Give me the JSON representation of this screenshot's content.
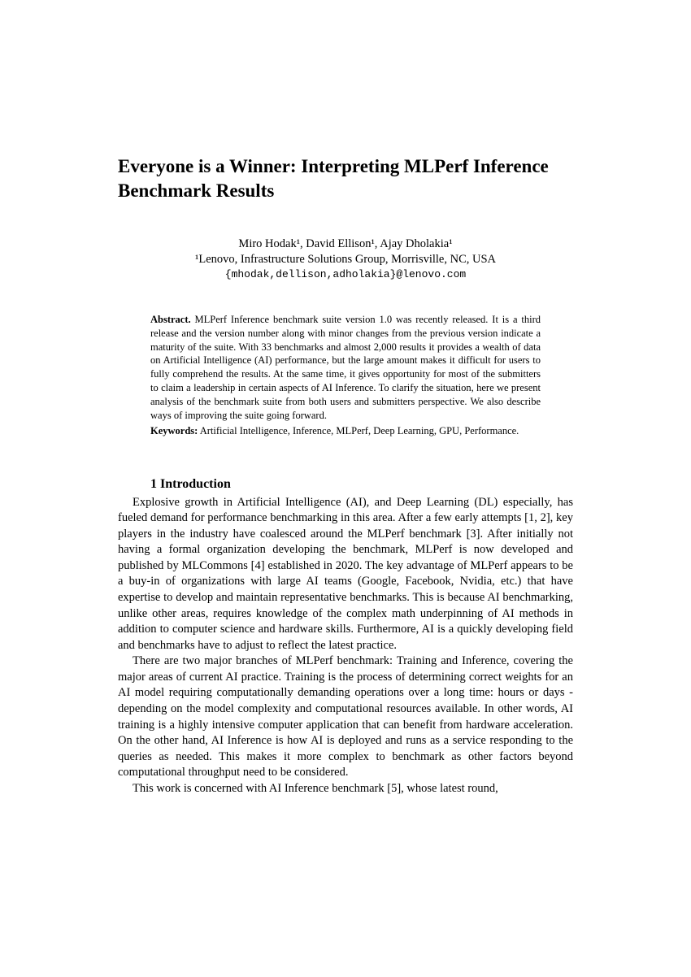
{
  "title": "Everyone is a Winner: Interpreting MLPerf Inference Benchmark Results",
  "authors_line": "Miro Hodak¹, David Ellison¹, Ajay Dholakia¹",
  "affiliation": "¹Lenovo, Infrastructure Solutions Group, Morrisville, NC, USA",
  "emails": "{mhodak,dellison,adholakia}@lenovo.com",
  "abstract_label": "Abstract.",
  "abstract_text": " MLPerf Inference benchmark suite version 1.0 was recently released. It is a third release and the version number along with minor changes from the previous version indicate a maturity of the suite. With 33 benchmarks and almost 2,000 results it provides a wealth of data on Artificial Intelligence (AI) performance, but the large amount makes it difficult for users to fully comprehend the results. At the same time, it gives opportunity for most of the submitters to claim a leadership in certain aspects of AI Inference. To clarify the situation, here we present analysis of the benchmark suite from both users and submitters perspective. We also describe ways of improving the suite going forward.",
  "keywords_label": "Keywords:",
  "keywords_text": " Artificial Intelligence, Inference, MLPerf, Deep Learning, GPU, Performance.",
  "section1_heading": "1 Introduction",
  "para1": "Explosive growth in Artificial Intelligence (AI), and Deep Learning (DL) especially, has fueled demand for performance benchmarking in this area. After a few early attempts [1, 2], key players in the industry have coalesced around the MLPerf benchmark [3]. After initially not having a formal organization developing the benchmark, MLPerf is now developed and published by MLCommons [4] established in 2020. The key advantage of MLPerf appears to be a buy-in of organizations with large AI teams (Google, Facebook, Nvidia, etc.) that have expertise to develop and maintain representative benchmarks. This is because AI benchmarking, unlike other areas, requires knowledge of the complex math underpinning of AI methods in addition to computer science and hardware skills. Furthermore, AI is a quickly developing field and benchmarks have to adjust to reflect the latest practice.",
  "para2": "There are two major branches of MLPerf benchmark: Training and Inference, covering the major areas of current AI practice. Training is the process of determining correct weights for an AI model requiring computationally demanding operations over a long time: hours or days - depending on the model complexity and computational resources available. In other words, AI training is a highly intensive computer application that can benefit from hardware acceleration. On the other hand, AI Inference is how AI is deployed and runs as a service responding to the queries as needed. This makes it more complex to benchmark as other factors beyond computational throughput need to be considered.",
  "para3": "This work is concerned with AI Inference benchmark [5], whose latest round,"
}
